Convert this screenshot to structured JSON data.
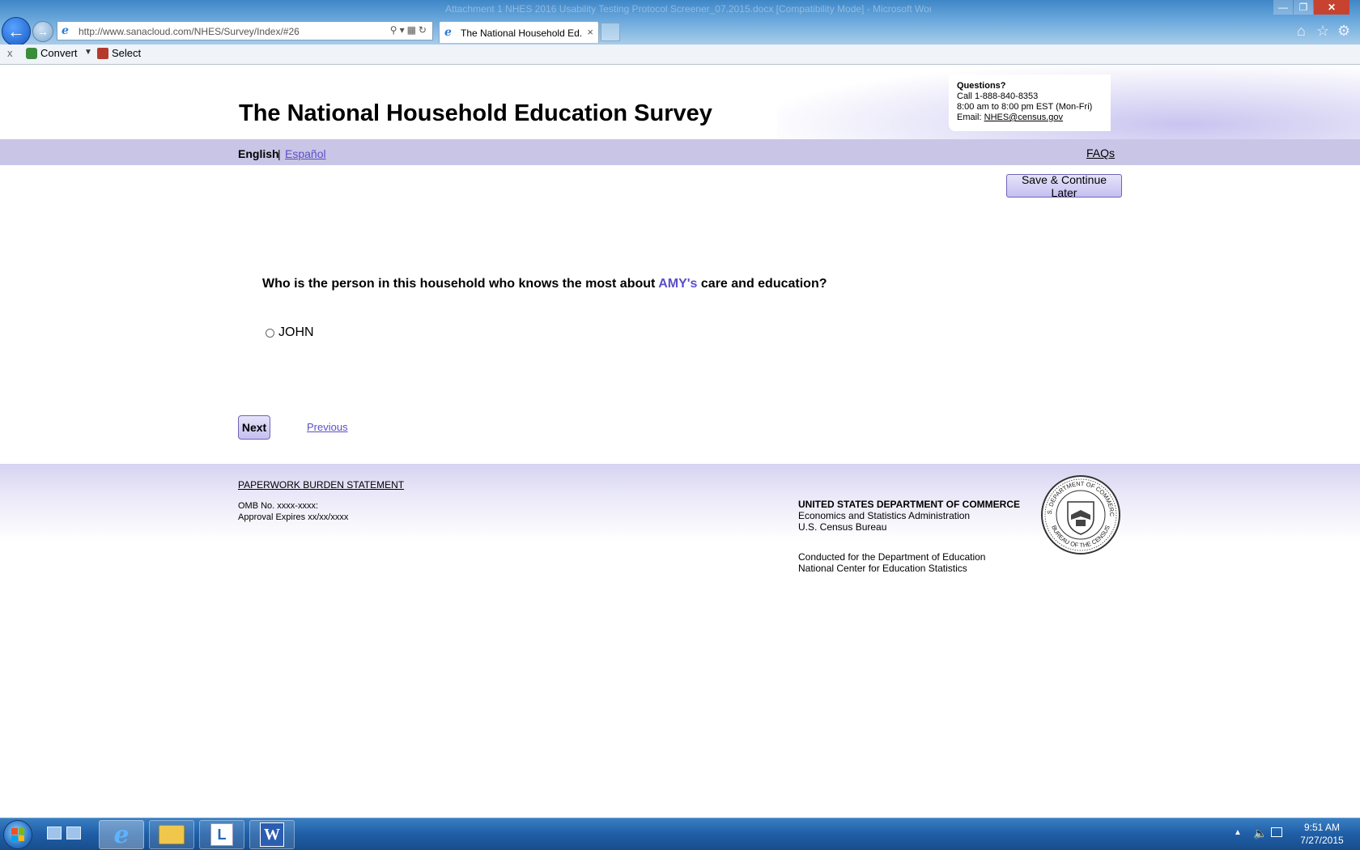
{
  "browser": {
    "window_title": "Attachment 1 NHES 2016 Usability Testing Protocol Screener_07.2015.docx [Compatibility Mode] - Microsoft Word",
    "address_url": "http://www.sanacloud.com/NHES/Survey/Index/#26",
    "tab_title": "The National Household Ed...",
    "tab_close": "×",
    "command_bar": {
      "close": "x",
      "convert_label": "Convert",
      "select_label": "Select"
    }
  },
  "header": {
    "title": "The National Household Education Survey",
    "help": {
      "title": "Questions?",
      "phone": "Call 1-888-840-8353",
      "hours": "8:00 am to 8:00 pm EST (Mon-Fri)",
      "email_label": "Email: ",
      "email": "NHES@census.gov"
    }
  },
  "language_bar": {
    "english": "English",
    "separator": "|",
    "espanol": "Español",
    "faqs": "FAQs"
  },
  "actions": {
    "save_later": "Save & Continue Later"
  },
  "question": {
    "prefix": "Who is the person in this household who knows the most about ",
    "name": "AMY's",
    "suffix": " care and education?",
    "options": [
      {
        "label": "JOHN",
        "selected": false
      }
    ]
  },
  "navigation": {
    "next": "Next",
    "previous": "Previous"
  },
  "footer": {
    "burden_link": "PAPERWORK BURDEN STATEMENT",
    "omb_line": "OMB No. xxxx-xxxx:",
    "approval_line": "Approval Expires xx/xx/xxxx",
    "agency_title": "UNITED STATES DEPARTMENT OF COMMERCE",
    "agency_line2": "Economics and Statistics Administration",
    "agency_line3": "U.S. Census Bureau",
    "conducted_line1": "Conducted for the Department of Education",
    "conducted_line2": "National Center for Education Statistics",
    "seal_text_top": "U.S. DEPARTMENT OF COMMERCE",
    "seal_text_bottom": "BUREAU OF THE CENSUS"
  },
  "taskbar": {
    "clock_time": "9:51 AM",
    "clock_date": "7/27/2015"
  },
  "colors": {
    "accent_purple": "#5a4fc7",
    "lang_bar_bg": "#c9c5e6",
    "button_border": "#6e65b8"
  }
}
